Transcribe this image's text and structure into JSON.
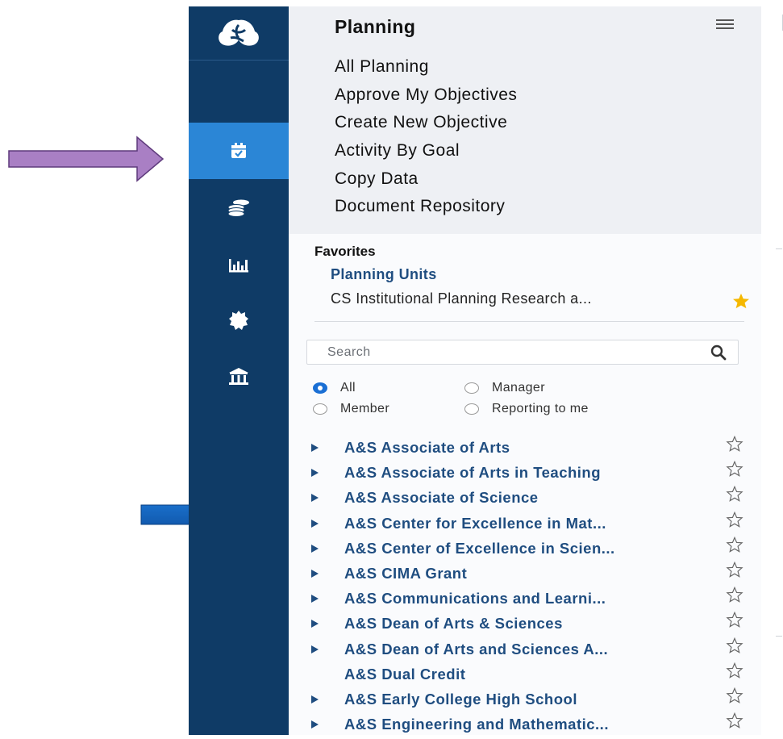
{
  "panel": {
    "title": "Planning",
    "menu_items": [
      {
        "label": "All Planning"
      },
      {
        "label": "Approve My Objectives"
      },
      {
        "label": "Create New Objective"
      },
      {
        "label": "Activity By Goal"
      },
      {
        "label": "Copy Data"
      },
      {
        "label": "Document Repository"
      }
    ]
  },
  "favorites": {
    "title": "Favorites",
    "link": "Planning Units",
    "item": "CS Institutional Planning Research a..."
  },
  "search": {
    "placeholder": "Search"
  },
  "filters": {
    "options": [
      {
        "label": "All",
        "checked": true
      },
      {
        "label": "Manager",
        "checked": false
      },
      {
        "label": "Member",
        "checked": false
      },
      {
        "label": "Reporting to me",
        "checked": false
      }
    ]
  },
  "units": [
    {
      "label": "A&S Associate of Arts",
      "expandable": true
    },
    {
      "label": "A&S Associate of Arts in Teaching",
      "expandable": true
    },
    {
      "label": "A&S Associate of Science",
      "expandable": true
    },
    {
      "label": "A&S Center for Excellence in Mat...",
      "expandable": true
    },
    {
      "label": "A&S Center of Excellence in Scien...",
      "expandable": true
    },
    {
      "label": "A&S CIMA Grant",
      "expandable": true
    },
    {
      "label": "A&S Communications and Learni...",
      "expandable": true
    },
    {
      "label": "A&S Dean of Arts & Sciences",
      "expandable": true
    },
    {
      "label": "A&S Dean of Arts and Sciences A...",
      "expandable": true
    },
    {
      "label": "A&S Dual Credit",
      "expandable": false
    },
    {
      "label": "A&S Early College High School",
      "expandable": true
    },
    {
      "label": "A&S Engineering and Mathematic...",
      "expandable": true
    }
  ],
  "colors": {
    "rail": "#0f3b66",
    "rail_active": "#2b86d6",
    "link": "#1f4d80",
    "favorite_star": "#f5b800",
    "annotation_purple": "#a97fc4",
    "annotation_blue": "#1565c0"
  },
  "icons": {
    "rail": [
      "logo-icon",
      "calendar-check-icon",
      "coins-icon",
      "bar-chart-icon",
      "badge-icon",
      "institution-icon"
    ]
  }
}
